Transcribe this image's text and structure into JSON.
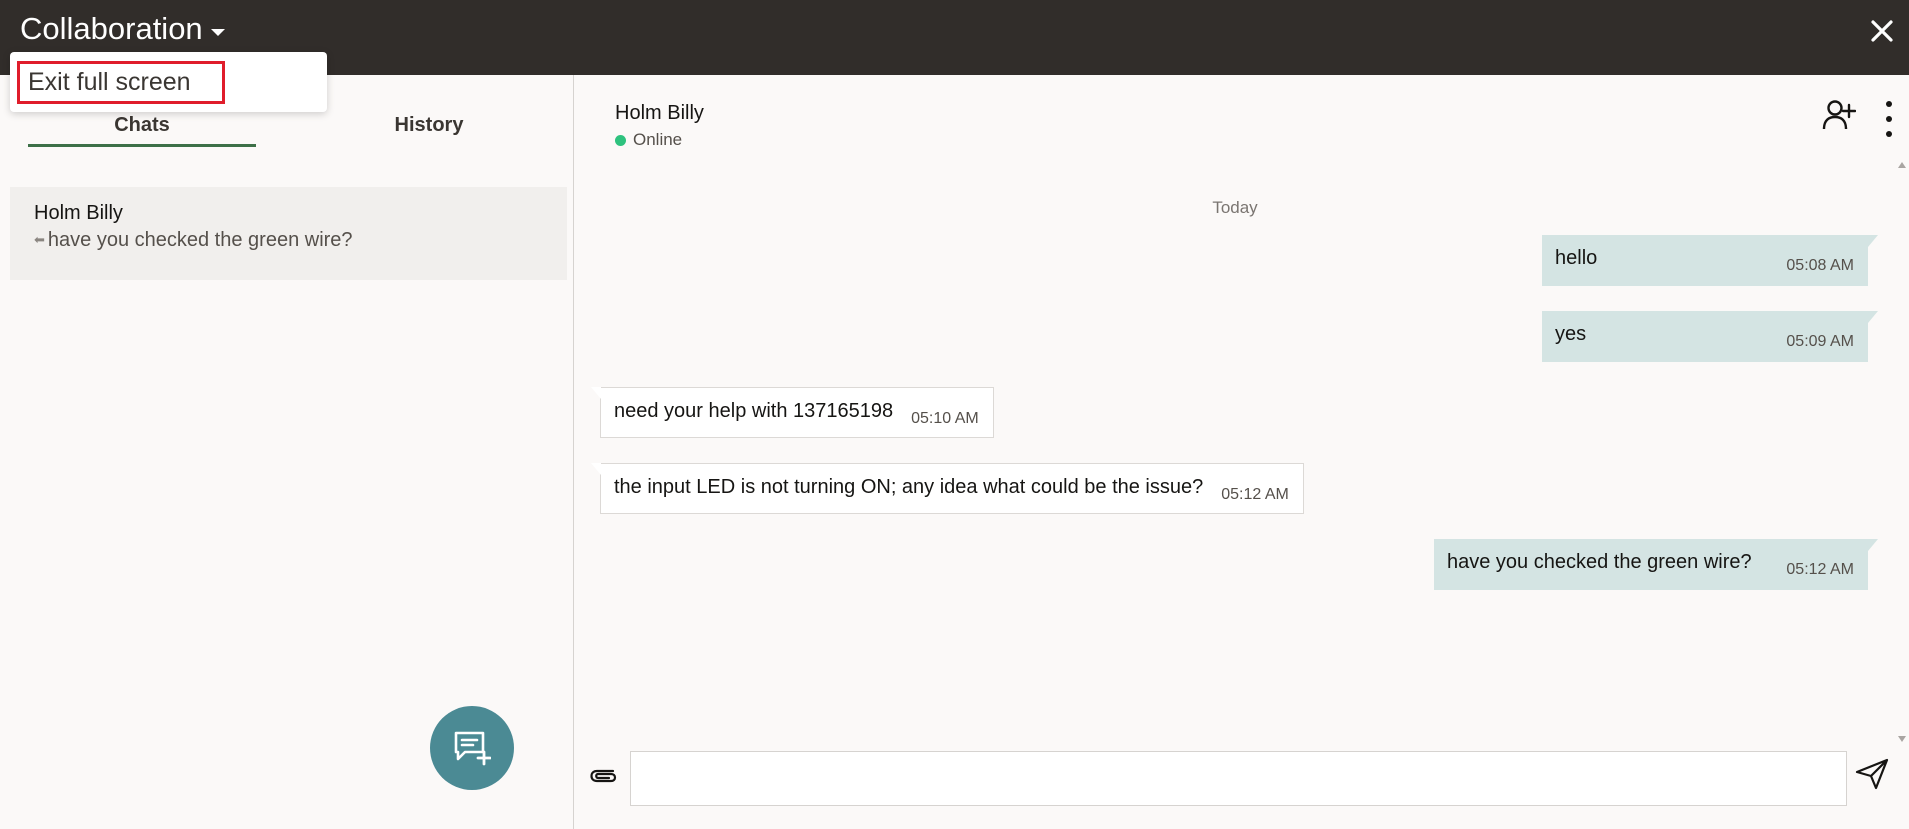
{
  "header": {
    "title": "Collaboration"
  },
  "menu": {
    "exit_full_screen": "Exit full screen"
  },
  "tabs": {
    "chats": "Chats",
    "history": "History"
  },
  "chat_list": [
    {
      "name": "Holm Billy",
      "preview": "have you checked the green wire?"
    }
  ],
  "conversation": {
    "contact_name": "Holm Billy",
    "status": "Online",
    "status_color": "#2ec27e",
    "date_separator": "Today",
    "messages": [
      {
        "direction": "out",
        "text": "hello",
        "time": "05:08 AM"
      },
      {
        "direction": "out",
        "text": "yes",
        "time": "05:09 AM"
      },
      {
        "direction": "in",
        "text": "need your help with 137165198",
        "time": "05:10 AM"
      },
      {
        "direction": "in",
        "text": "the input LED is not turning ON; any idea what could be the issue?",
        "time": "05:12 AM"
      },
      {
        "direction": "out",
        "text": "have you checked the green wire?",
        "time": "05:12 AM"
      }
    ]
  },
  "composer": {
    "value": "",
    "placeholder": ""
  },
  "colors": {
    "header_bg": "#312d2a",
    "outgoing_bubble": "#d4e4e3",
    "active_tab": "#3d7048",
    "fab": "#4b8a94",
    "highlight": "#e01d2b"
  },
  "icons": {
    "header_caret": "caret-down-icon",
    "close": "close-icon",
    "reply": "reply-arrow-icon",
    "new_chat": "new-chat-icon",
    "add_user": "add-user-icon",
    "more": "more-vertical-icon",
    "attach": "attach-icon",
    "send": "send-icon"
  }
}
